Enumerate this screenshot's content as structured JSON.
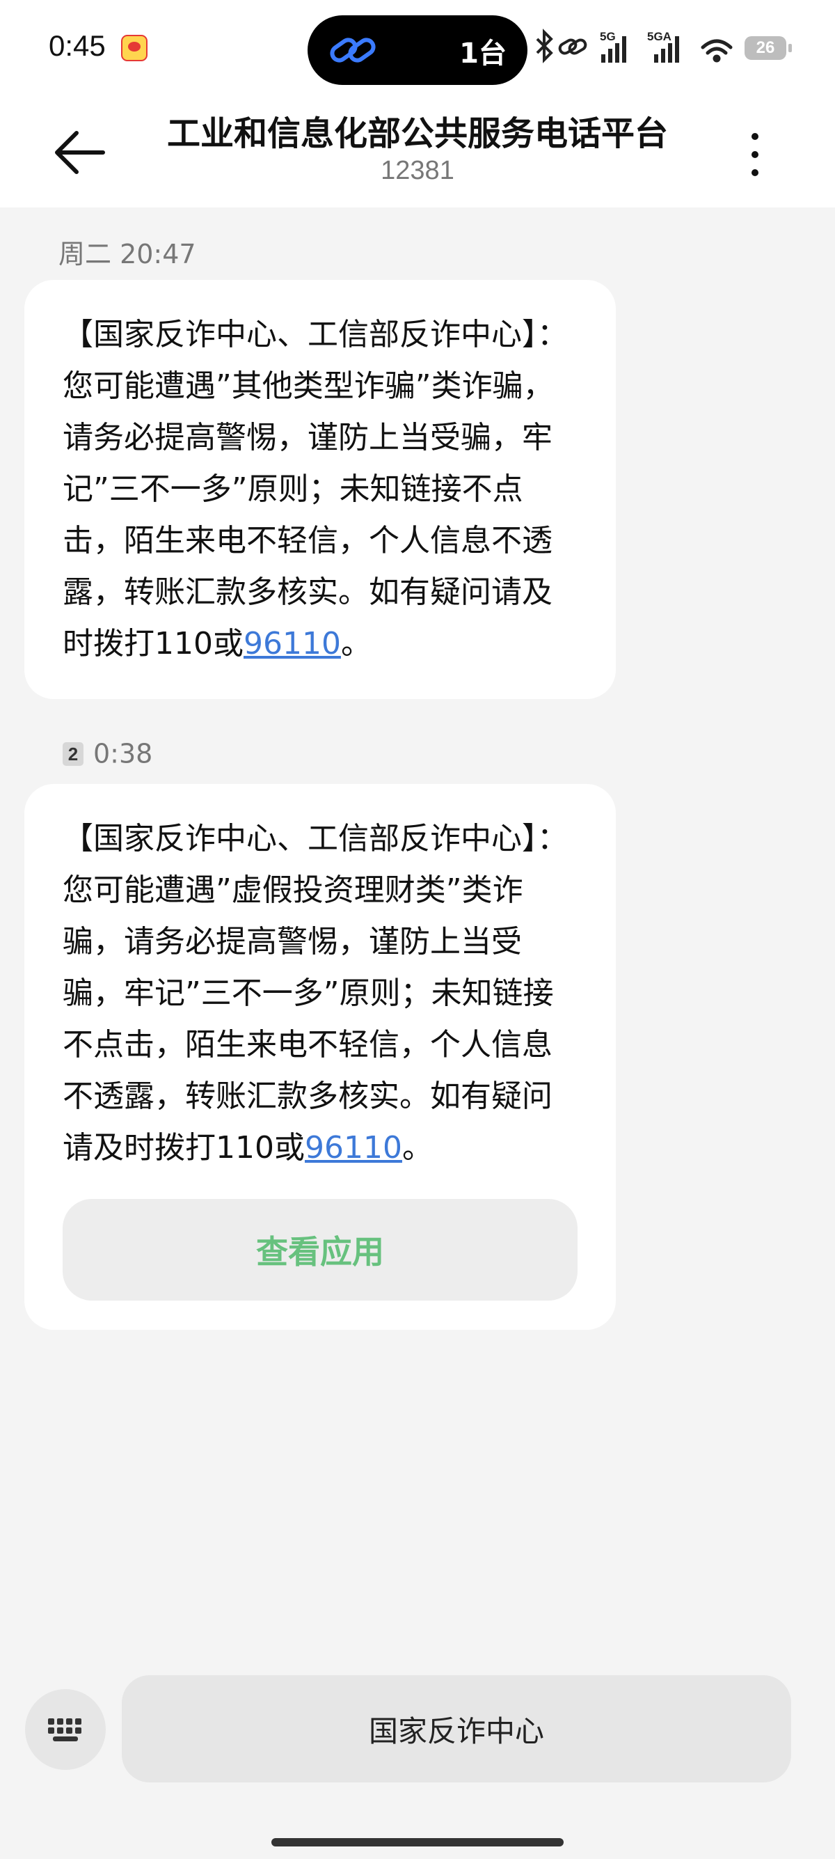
{
  "status_bar": {
    "time": "0:45",
    "island_count": "1台",
    "battery": "26",
    "network_labels": [
      "5G",
      "5GA"
    ]
  },
  "header": {
    "title": "工业和信息化部公共服务电话平台",
    "subtitle": "12381"
  },
  "messages": [
    {
      "timestamp": "周二 20:47",
      "sim": "",
      "text": "【国家反诈中心、工信部反诈中心】：您可能遭遇”其他类型诈骗”类诈骗，请务必提高警惕，谨防上当受骗，牢记”三不一多”原则；未知链接不点击，陌生来电不轻信，个人信息不透露，转账汇款多核实。如有疑问请及时拨打110或",
      "link": "96110",
      "tail": "。"
    },
    {
      "timestamp": "0:38",
      "sim": "2",
      "text": "【国家反诈中心、工信部反诈中心】：您可能遭遇”虚假投资理财类”类诈骗，请务必提高警惕，谨防上当受骗，牢记”三不一多”原则；未知链接不点击，陌生来电不轻信，个人信息不透露，转账汇款多核实。如有疑问请及时拨打110或",
      "link": "96110",
      "tail": "。",
      "action_label": "查看应用"
    }
  ],
  "input": {
    "value": "国家反诈中心"
  },
  "colors": {
    "accent_link": "#3d79d8",
    "action_text": "#67c17e",
    "background": "#f4f4f4",
    "bubble": "#ffffff"
  },
  "icons": {
    "back": "arrow-left-icon",
    "more": "more-vertical-icon",
    "keyboard": "keyboard-icon",
    "island": "link-icon"
  }
}
